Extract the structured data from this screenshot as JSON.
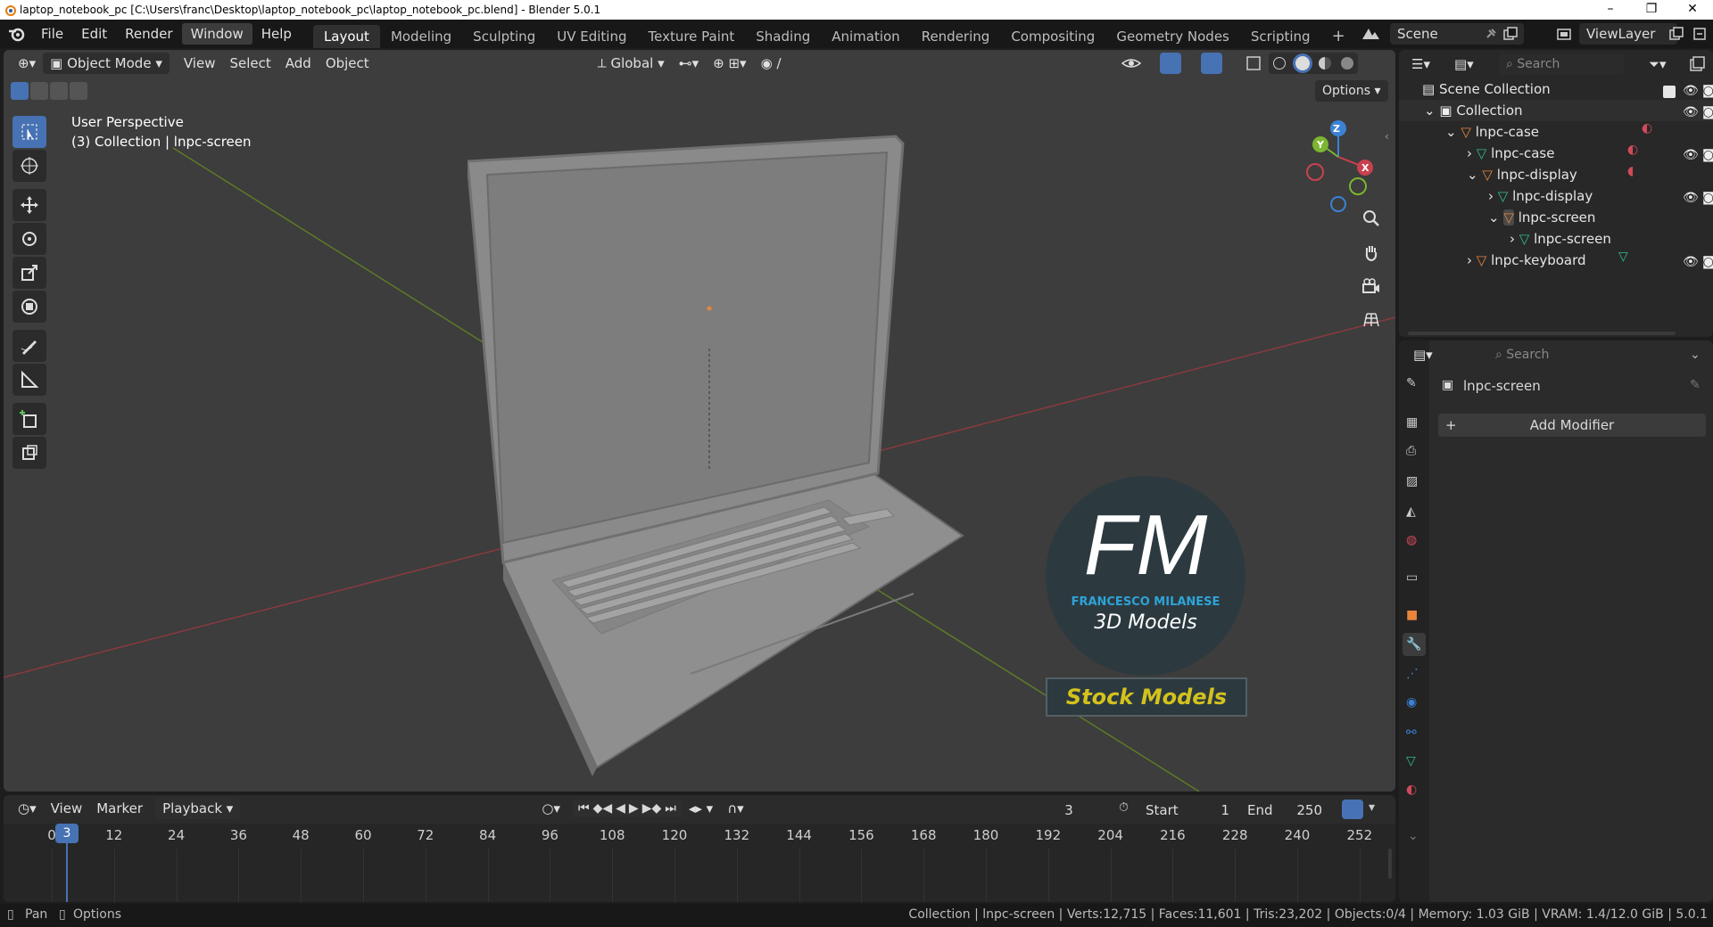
{
  "window": {
    "title": "laptop_notebook_pc [C:\\Users\\franc\\Desktop\\laptop_notebook_pc\\laptop_notebook_pc.blend] - Blender 5.0.1",
    "minimize": "–",
    "restore": "❐",
    "close": "✕"
  },
  "menu": [
    "File",
    "Edit",
    "Render",
    "Window",
    "Help"
  ],
  "workspaces": [
    "Layout",
    "Modeling",
    "Sculpting",
    "UV Editing",
    "Texture Paint",
    "Shading",
    "Animation",
    "Rendering",
    "Compositing",
    "Geometry Nodes",
    "Scripting"
  ],
  "scene": {
    "scene_name": "Scene",
    "view_layer": "ViewLayer"
  },
  "viewport": {
    "mode": "Object Mode",
    "menus": [
      "View",
      "Select",
      "Add",
      "Object"
    ],
    "transform_orientation": "Global",
    "options_label": "Options",
    "overlay_line1": "User Perspective",
    "overlay_line2": "(3) Collection | lnpc-screen",
    "gizmo": {
      "x": "X",
      "y": "Y",
      "z": "Z"
    },
    "watermark": {
      "initials": "FM",
      "name": "FRANCESCO MILANESE",
      "tagline": "3D Models",
      "banner": "Stock Models"
    }
  },
  "outliner": {
    "search_placeholder": "Search",
    "scene_collection": "Scene Collection",
    "rows": [
      {
        "label": "Collection",
        "depth": 0
      },
      {
        "label": "lnpc-case",
        "depth": 1
      },
      {
        "label": "lnpc-case",
        "depth": 2
      },
      {
        "label": "lnpc-display",
        "depth": 2
      },
      {
        "label": "lnpc-display",
        "depth": 3
      },
      {
        "label": "lnpc-screen",
        "depth": 3
      },
      {
        "label": "lnpc-screen",
        "depth": 4
      },
      {
        "label": "lnpc-keyboard",
        "depth": 2
      }
    ]
  },
  "properties": {
    "search_placeholder": "Search",
    "object_name": "lnpc-screen",
    "add_modifier": "Add Modifier"
  },
  "timeline": {
    "menus": [
      "View",
      "Marker"
    ],
    "playback": "Playback",
    "current_frame": "3",
    "start_label": "Start",
    "start_value": "1",
    "end_label": "End",
    "end_value": "250",
    "ticks": [
      "0",
      "12",
      "24",
      "36",
      "48",
      "60",
      "72",
      "84",
      "96",
      "108",
      "120",
      "132",
      "144",
      "156",
      "168",
      "180",
      "192",
      "204",
      "216",
      "228",
      "240",
      "252"
    ]
  },
  "status": {
    "left_items": [
      "Pan",
      "Options"
    ],
    "right_text": "Collection | lnpc-screen | Verts:12,715 | Faces:11,601 | Tris:23,202 | Objects:0/4 | Memory: 1.03 GiB | VRAM: 1.4/12.0 GiB | 5.0.1"
  },
  "colors": {
    "accent": "#4772b3",
    "mesh_orange": "#e8843c",
    "mesh_green": "#2fbf8a",
    "axis_x": "#c8424e",
    "axis_y": "#7bb531",
    "axis_z": "#3b82d4"
  }
}
